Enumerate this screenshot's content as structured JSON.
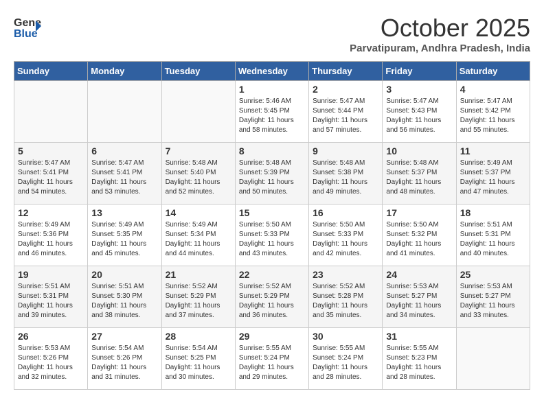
{
  "header": {
    "logo_line1": "General",
    "logo_line2": "Blue",
    "month": "October 2025",
    "location": "Parvatipuram, Andhra Pradesh, India"
  },
  "weekdays": [
    "Sunday",
    "Monday",
    "Tuesday",
    "Wednesday",
    "Thursday",
    "Friday",
    "Saturday"
  ],
  "weeks": [
    [
      {
        "day": "",
        "info": ""
      },
      {
        "day": "",
        "info": ""
      },
      {
        "day": "",
        "info": ""
      },
      {
        "day": "1",
        "info": "Sunrise: 5:46 AM\nSunset: 5:45 PM\nDaylight: 11 hours\nand 58 minutes."
      },
      {
        "day": "2",
        "info": "Sunrise: 5:47 AM\nSunset: 5:44 PM\nDaylight: 11 hours\nand 57 minutes."
      },
      {
        "day": "3",
        "info": "Sunrise: 5:47 AM\nSunset: 5:43 PM\nDaylight: 11 hours\nand 56 minutes."
      },
      {
        "day": "4",
        "info": "Sunrise: 5:47 AM\nSunset: 5:42 PM\nDaylight: 11 hours\nand 55 minutes."
      }
    ],
    [
      {
        "day": "5",
        "info": "Sunrise: 5:47 AM\nSunset: 5:41 PM\nDaylight: 11 hours\nand 54 minutes."
      },
      {
        "day": "6",
        "info": "Sunrise: 5:47 AM\nSunset: 5:41 PM\nDaylight: 11 hours\nand 53 minutes."
      },
      {
        "day": "7",
        "info": "Sunrise: 5:48 AM\nSunset: 5:40 PM\nDaylight: 11 hours\nand 52 minutes."
      },
      {
        "day": "8",
        "info": "Sunrise: 5:48 AM\nSunset: 5:39 PM\nDaylight: 11 hours\nand 50 minutes."
      },
      {
        "day": "9",
        "info": "Sunrise: 5:48 AM\nSunset: 5:38 PM\nDaylight: 11 hours\nand 49 minutes."
      },
      {
        "day": "10",
        "info": "Sunrise: 5:48 AM\nSunset: 5:37 PM\nDaylight: 11 hours\nand 48 minutes."
      },
      {
        "day": "11",
        "info": "Sunrise: 5:49 AM\nSunset: 5:37 PM\nDaylight: 11 hours\nand 47 minutes."
      }
    ],
    [
      {
        "day": "12",
        "info": "Sunrise: 5:49 AM\nSunset: 5:36 PM\nDaylight: 11 hours\nand 46 minutes."
      },
      {
        "day": "13",
        "info": "Sunrise: 5:49 AM\nSunset: 5:35 PM\nDaylight: 11 hours\nand 45 minutes."
      },
      {
        "day": "14",
        "info": "Sunrise: 5:49 AM\nSunset: 5:34 PM\nDaylight: 11 hours\nand 44 minutes."
      },
      {
        "day": "15",
        "info": "Sunrise: 5:50 AM\nSunset: 5:33 PM\nDaylight: 11 hours\nand 43 minutes."
      },
      {
        "day": "16",
        "info": "Sunrise: 5:50 AM\nSunset: 5:33 PM\nDaylight: 11 hours\nand 42 minutes."
      },
      {
        "day": "17",
        "info": "Sunrise: 5:50 AM\nSunset: 5:32 PM\nDaylight: 11 hours\nand 41 minutes."
      },
      {
        "day": "18",
        "info": "Sunrise: 5:51 AM\nSunset: 5:31 PM\nDaylight: 11 hours\nand 40 minutes."
      }
    ],
    [
      {
        "day": "19",
        "info": "Sunrise: 5:51 AM\nSunset: 5:31 PM\nDaylight: 11 hours\nand 39 minutes."
      },
      {
        "day": "20",
        "info": "Sunrise: 5:51 AM\nSunset: 5:30 PM\nDaylight: 11 hours\nand 38 minutes."
      },
      {
        "day": "21",
        "info": "Sunrise: 5:52 AM\nSunset: 5:29 PM\nDaylight: 11 hours\nand 37 minutes."
      },
      {
        "day": "22",
        "info": "Sunrise: 5:52 AM\nSunset: 5:29 PM\nDaylight: 11 hours\nand 36 minutes."
      },
      {
        "day": "23",
        "info": "Sunrise: 5:52 AM\nSunset: 5:28 PM\nDaylight: 11 hours\nand 35 minutes."
      },
      {
        "day": "24",
        "info": "Sunrise: 5:53 AM\nSunset: 5:27 PM\nDaylight: 11 hours\nand 34 minutes."
      },
      {
        "day": "25",
        "info": "Sunrise: 5:53 AM\nSunset: 5:27 PM\nDaylight: 11 hours\nand 33 minutes."
      }
    ],
    [
      {
        "day": "26",
        "info": "Sunrise: 5:53 AM\nSunset: 5:26 PM\nDaylight: 11 hours\nand 32 minutes."
      },
      {
        "day": "27",
        "info": "Sunrise: 5:54 AM\nSunset: 5:26 PM\nDaylight: 11 hours\nand 31 minutes."
      },
      {
        "day": "28",
        "info": "Sunrise: 5:54 AM\nSunset: 5:25 PM\nDaylight: 11 hours\nand 30 minutes."
      },
      {
        "day": "29",
        "info": "Sunrise: 5:55 AM\nSunset: 5:24 PM\nDaylight: 11 hours\nand 29 minutes."
      },
      {
        "day": "30",
        "info": "Sunrise: 5:55 AM\nSunset: 5:24 PM\nDaylight: 11 hours\nand 28 minutes."
      },
      {
        "day": "31",
        "info": "Sunrise: 5:55 AM\nSunset: 5:23 PM\nDaylight: 11 hours\nand 28 minutes."
      },
      {
        "day": "",
        "info": ""
      }
    ]
  ]
}
